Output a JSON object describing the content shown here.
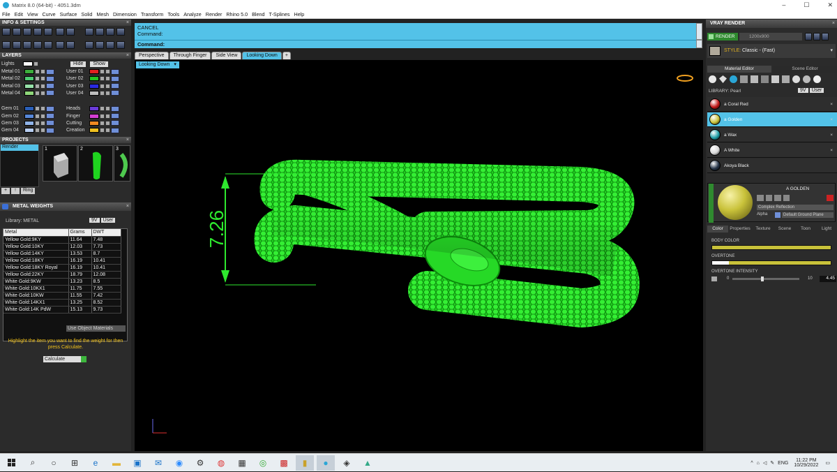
{
  "window": {
    "title": "Matrix 8.0 (64-bit) - 4051.3dm",
    "controls": [
      "–",
      "☐",
      "✕"
    ]
  },
  "menu": [
    "File",
    "Edit",
    "View",
    "Curve",
    "Surface",
    "Solid",
    "Mesh",
    "Dimension",
    "Transform",
    "Tools",
    "Analyze",
    "Render",
    "Rhino 5.0",
    "Blend",
    "T-Splines",
    "Help"
  ],
  "left": {
    "info_title": "INFO & SETTINGS",
    "layers_title": "LAYERS",
    "lights_label": "Lights",
    "hide_label": "Hide",
    "show_label": "Show",
    "layers_left": [
      {
        "name": "Metal 01",
        "color": "#3cae3c"
      },
      {
        "name": "Metal 02",
        "color": "#4ecb72"
      },
      {
        "name": "Metal 03",
        "color": "#96e0a8"
      },
      {
        "name": "Metal 04",
        "color": "#8fd67a"
      },
      {
        "name": "Gem 01",
        "color": "#2a5fb8"
      },
      {
        "name": "Gem 02",
        "color": "#5787d8"
      },
      {
        "name": "Gem 03",
        "color": "#8fb3e8"
      },
      {
        "name": "Gem 04",
        "color": "#b7cdf0"
      }
    ],
    "layers_right": [
      {
        "name": "User 01",
        "color": "#e02020"
      },
      {
        "name": "User 02",
        "color": "#24c324"
      },
      {
        "name": "User 03",
        "color": "#2a2ae0"
      },
      {
        "name": "User 04",
        "color": "#bdbdbd"
      },
      {
        "name": "Heads",
        "color": "#6a3bd8"
      },
      {
        "name": "Finger",
        "color": "#d33fd3"
      },
      {
        "name": "Cutting",
        "color": "#f08a22"
      },
      {
        "name": "Creation",
        "color": "#f0c020"
      }
    ],
    "projects_title": "PROJECTS",
    "projects_list": [
      "Render"
    ],
    "project_numbers": [
      "1",
      "2",
      "3"
    ],
    "ring_btn": "Ring",
    "metal_weights_title": "METAL WEIGHTS",
    "library_label": "Library: METAL",
    "lib_buttons": [
      "9V",
      "User"
    ],
    "table_headers": [
      "Metal",
      "Grams",
      "DWT"
    ],
    "table_rows": [
      [
        "Yellow Gold:9KY",
        "11.64",
        "7.48"
      ],
      [
        "Yellow Gold:10KY",
        "12.03",
        "7.73"
      ],
      [
        "Yellow Gold:14KY",
        "13.53",
        "8.7"
      ],
      [
        "Yellow Gold:18KY",
        "16.19",
        "10.41"
      ],
      [
        "Yellow Gold:18KY Royal",
        "16.19",
        "10.41"
      ],
      [
        "Yellow Gold:22KY",
        "18.79",
        "12.08"
      ],
      [
        "White Gold:9KW",
        "13.23",
        "8.5"
      ],
      [
        "White Gold:10KX1",
        "11.75",
        "7.55"
      ],
      [
        "White Gold:10KW",
        "11.55",
        "7.42"
      ],
      [
        "White Gold:14KX1",
        "13.25",
        "8.52"
      ],
      [
        "White Gold:14K PdW",
        "15.13",
        "9.73"
      ]
    ],
    "use_object_materials": "Use Object Materials",
    "hint": "Highlight the item you want to find the weight for then press Calculate.",
    "calculate": "Calculate"
  },
  "command": {
    "line1": "CANCEL",
    "line2": "Command:",
    "prompt": "Command:"
  },
  "viewport": {
    "tabs": [
      "Perspective",
      "Through Finger",
      "Side View",
      "Looking Down"
    ],
    "active_tab": "Looking Down",
    "label": "Looking Down",
    "dimension": "7.26"
  },
  "right": {
    "title": "VRAY RENDER",
    "render_btn": "RENDER",
    "resolution": "1200x900",
    "style_label": "STYLE:",
    "style_value": "Classic - (Fast)",
    "tabs": [
      "Material Editor",
      "Scene Editor"
    ],
    "library_label": "LIBRARY: Pearl",
    "lib_buttons": [
      "9V",
      "User"
    ],
    "materials": [
      {
        "name": "a Coral Red",
        "color": "#c21818"
      },
      {
        "name": "a Golden",
        "color": "#c9c23a"
      },
      {
        "name": "a Wax",
        "color": "#1f9fa8"
      },
      {
        "name": "A White",
        "color": "#d8d8d8"
      },
      {
        "name": "Akoya Black",
        "color": "#263448"
      }
    ],
    "selected_material": "A GOLDEN",
    "complex_reflection": "Complex Reflection",
    "alpha_label": "Alpha",
    "ground_plane": "Default Ground Plane",
    "prop_tabs": [
      "Color",
      "Properties",
      "Texture",
      "Scene",
      "Toon",
      "Light"
    ],
    "body_color": "BODY COLOR",
    "overtone": "OVERTONE",
    "overtone_intensity": "OVERTONE INTENSITY",
    "intensity_min": "0",
    "intensity_max": "10",
    "intensity_value": "4.45",
    "intensity_fraction": 0.445
  },
  "taskbar": {
    "time": "11:22 PM",
    "date": "10/29/2022",
    "lang": "ENG"
  }
}
